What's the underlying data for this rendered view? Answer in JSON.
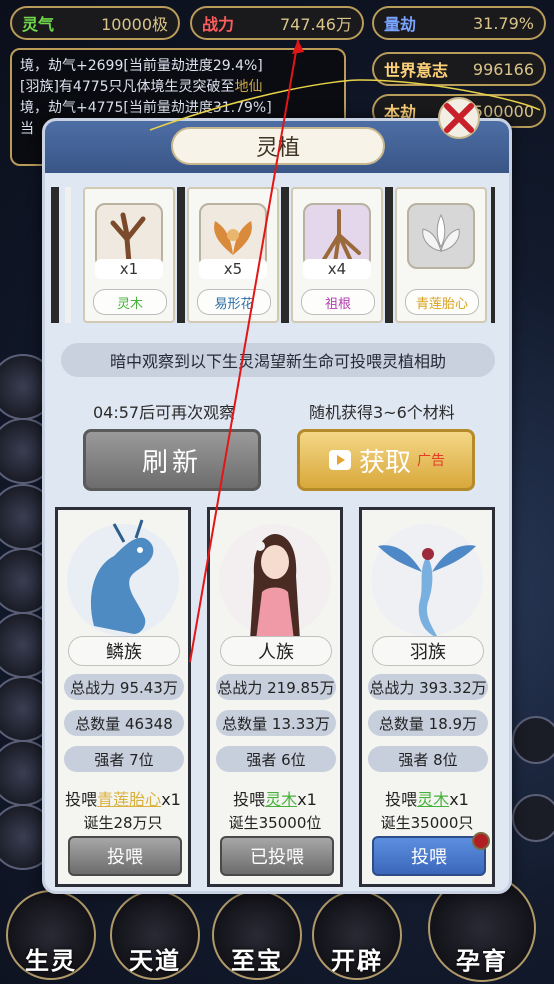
{
  "hud": {
    "lingqi": {
      "label": "灵气",
      "value": "10000极"
    },
    "zhanli": {
      "label": "战力",
      "value": "747.46万"
    },
    "liangjie": {
      "label": "量劫",
      "value": "31.79%"
    },
    "shijie": {
      "label": "世界意志",
      "value": "996166"
    },
    "benjie": {
      "label": "本劫",
      "value": "500000"
    }
  },
  "log": {
    "line1": "境，劫气+2699[当前量劫进度29.4%]",
    "line2_pre": "[羽族]有4775只凡体境生灵突破至",
    "line2_hl": "地仙",
    "line3": "境，劫气+4775[当前量劫进度31.79%]",
    "line4": "当"
  },
  "modal": {
    "title": "灵植",
    "materials": [
      {
        "count": "x1",
        "name": "灵木",
        "color": "#47b23b"
      },
      {
        "count": "x5",
        "name": "易形花",
        "color": "#2c6fa7"
      },
      {
        "count": "x4",
        "name": "祖根",
        "color": "#b43fb0"
      },
      {
        "count": "",
        "name": "青莲胎心",
        "color": "#d9a21b"
      }
    ],
    "notice": "暗中观察到以下生灵渴望新生命可投喂灵植相助",
    "timer": "04:57后可再次观察",
    "random": "随机获得3~6个材料",
    "refresh_label": "刷新",
    "get_label": "获取",
    "ad_label": "广告",
    "creatures": [
      {
        "race": "鳞族",
        "power": "总战力 95.43万",
        "count": "总数量 46348",
        "strong": "强者 7位",
        "feed_prefix": "投喂",
        "feed_item": "青莲胎心",
        "feed_suffix": "x1",
        "birth": "诞生28万只",
        "button": "投喂"
      },
      {
        "race": "人族",
        "power": "总战力 219.85万",
        "count": "总数量 13.33万",
        "strong": "强者 6位",
        "feed_prefix": "投喂",
        "feed_item": "灵木",
        "feed_suffix": "x1",
        "birth": "诞生35000位",
        "button": "已投喂"
      },
      {
        "race": "羽族",
        "power": "总战力 393.32万",
        "count": "总数量 18.9万",
        "strong": "强者 8位",
        "feed_prefix": "投喂",
        "feed_item": "灵木",
        "feed_suffix": "x1",
        "birth": "诞生35000只",
        "button": "投喂"
      }
    ]
  },
  "bottom_nav": [
    "生灵",
    "天道",
    "至宝",
    "开辟",
    "孕育"
  ],
  "colors": {
    "accent_gold": "#b99b5a",
    "modal_header": "#3a5687",
    "alert_red": "#b01e24"
  }
}
